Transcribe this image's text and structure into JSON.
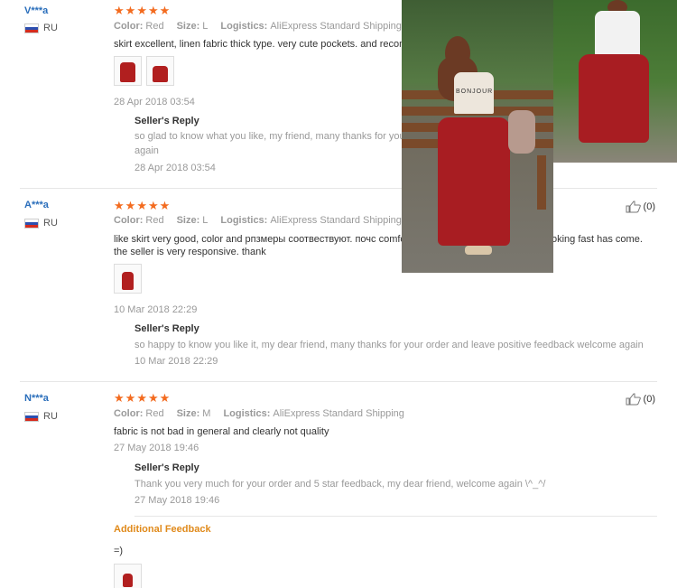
{
  "reviews": [
    {
      "user": "V***a",
      "country": "RU",
      "stars": 5,
      "color_label": "Color:",
      "color": "Red",
      "size_label": "Size:",
      "size": "L",
      "logistics_label": "Logistics:",
      "logistics": "AliExpress Standard Shipping",
      "text": "skirt excellent, linen fabric thick type. very cute pockets. and recomm",
      "date": "28 Apr 2018 03:54",
      "reply_title": "Seller's Reply",
      "reply_text_line1": "so glad to know what you like, my friend, many thanks for you",
      "reply_text_line2": "again",
      "reply_date": "28 Apr 2018 03:54"
    },
    {
      "user": "A***a",
      "country": "RU",
      "stars": 5,
      "color_label": "Color:",
      "color": "Red",
      "size_label": "Size:",
      "size": "L",
      "logistics_label": "Logistics:",
      "logistics": "AliExpress Standard Shipping",
      "text_line1": "like skirt very good, color and рпзмеры соотвествуют. почс comfo",
      "text_line1_end": "oking fast has come.",
      "text_line2": "the seller is very responsive. thank",
      "helpful": "(0)",
      "date": "10 Mar 2018 22:29",
      "reply_title": "Seller's Reply",
      "reply_text": "so happy to know you like it, my dear friend, many thanks for your order and leave positive feedback welcome again",
      "reply_date": "10 Mar 2018 22:29"
    },
    {
      "user": "N***a",
      "country": "RU",
      "stars": 5,
      "color_label": "Color:",
      "color": "Red",
      "size_label": "Size:",
      "size": "M",
      "logistics_label": "Logistics:",
      "logistics": "AliExpress Standard Shipping",
      "text": "fabric is not bad in general and clearly not quality",
      "helpful": "(0)",
      "date": "27 May 2018 19:46",
      "reply_title": "Seller's Reply",
      "reply_text": "Thank you very much for your order and 5 star feedback, my dear friend, welcome again \\^_^/",
      "reply_date": "27 May 2018 19:46",
      "additional_title": "Additional Feedback",
      "additional_text": "=)"
    }
  ],
  "photo_tshirt_text": "BONJOUR",
  "colors": {
    "star": "#f36b1f",
    "link": "#2a6ebb",
    "additional": "#e08a1b",
    "skirt": "#a81d22"
  }
}
